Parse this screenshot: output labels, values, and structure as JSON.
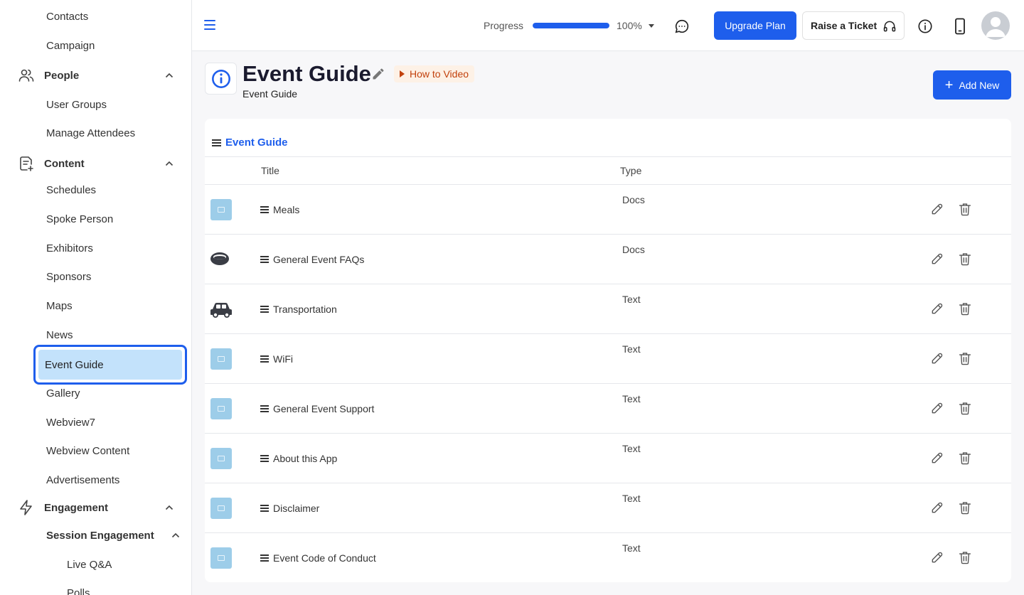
{
  "sidebar": {
    "contacts": "Contacts",
    "campaign": "Campaign",
    "people": "People",
    "user_groups": "User Groups",
    "manage_attendees": "Manage Attendees",
    "content": "Content",
    "schedules": "Schedules",
    "spoke_person": "Spoke Person",
    "exhibitors": "Exhibitors",
    "sponsors": "Sponsors",
    "maps": "Maps",
    "news": "News",
    "event_guide": "Event Guide",
    "gallery": "Gallery",
    "webview7": "Webview7",
    "webview_content": "Webview Content",
    "advertisements": "Advertisements",
    "engagement": "Engagement",
    "session_engagement": "Session Engagement",
    "live_qa": "Live Q&A",
    "polls": "Polls"
  },
  "topbar": {
    "progress_label": "Progress",
    "progress_value": 1.0,
    "progress_text": "100%",
    "upgrade_label": "Upgrade Plan",
    "ticket_label": "Raise a Ticket"
  },
  "header": {
    "title": "Event Guide",
    "subtitle": "Event Guide",
    "how_to_label": "How to Video",
    "add_new_label": "Add New"
  },
  "card": {
    "title": "Event Guide",
    "columns": {
      "title": "Title",
      "type": "Type"
    },
    "rows": [
      {
        "title": "Meals",
        "type": "Docs",
        "icon": "image-placeholder-icon"
      },
      {
        "title": "General Event FAQs",
        "type": "Docs",
        "icon": "disc-icon"
      },
      {
        "title": "Transportation",
        "type": "Text",
        "icon": "car-icon"
      },
      {
        "title": "WiFi",
        "type": "Text",
        "icon": "image-placeholder-icon"
      },
      {
        "title": "General Event Support",
        "type": "Text",
        "icon": "image-placeholder-icon"
      },
      {
        "title": "About this App",
        "type": "Text",
        "icon": "image-placeholder-icon"
      },
      {
        "title": "Disclaimer",
        "type": "Text",
        "icon": "image-placeholder-icon"
      },
      {
        "title": "Event Code of Conduct",
        "type": "Text",
        "icon": "image-placeholder-icon"
      }
    ]
  },
  "colors": {
    "accent": "#1e5eec",
    "active_bg": "#c3e2fb",
    "thumb": "#9dcde9",
    "how_to_text": "#c2410c"
  }
}
